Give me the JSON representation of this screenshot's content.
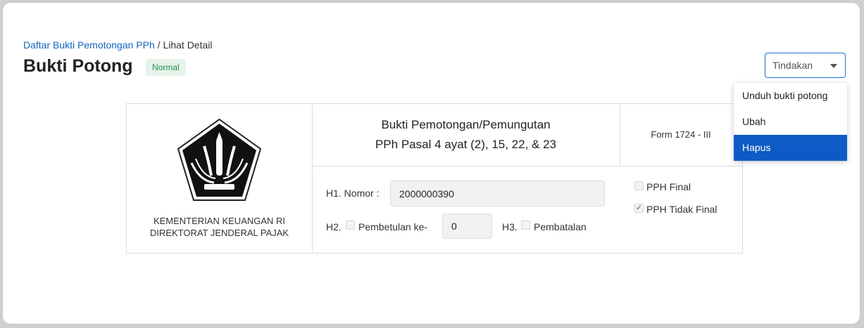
{
  "breadcrumb": {
    "parent": "Daftar Bukti Pemotongan PPh",
    "separator": " / ",
    "current": "Lihat Detail"
  },
  "page": {
    "title": "Bukti Potong",
    "status_badge": "Normal"
  },
  "actions": {
    "label": "Tindakan",
    "menu": [
      {
        "label": "Unduh bukti potong",
        "active": false
      },
      {
        "label": "Ubah",
        "active": false
      },
      {
        "label": "Hapus",
        "active": true
      }
    ]
  },
  "document": {
    "org_line1": "KEMENTERIAN KEUANGAN RI",
    "org_line2": "DIREKTORAT JENDERAL PAJAK",
    "heading_line1": "Bukti Pemotongan/Pemungutan",
    "heading_line2": "PPh Pasal 4 ayat (2), 15, 22, & 23",
    "form_code": "Form 1724 - III",
    "h1_label": "H1. Nomor :",
    "h1_value": "2000000390",
    "h2_label": "H2.",
    "h2_checkbox_label": "Pembetulan ke-",
    "h2_value": "0",
    "h3_label": "H3.",
    "h3_checkbox_label": "Pembatalan",
    "pph_final_label": "PPH Final",
    "pph_tidak_final_label": "PPH Tidak Final",
    "pph_final_checked": false,
    "pph_tidak_final_checked": true
  },
  "colors": {
    "accent": "#1f6fd1",
    "link": "#1565c0",
    "menu_active": "#0d5bc6",
    "badge_bg": "#e6f4ea",
    "badge_text": "#1e8e4e"
  }
}
